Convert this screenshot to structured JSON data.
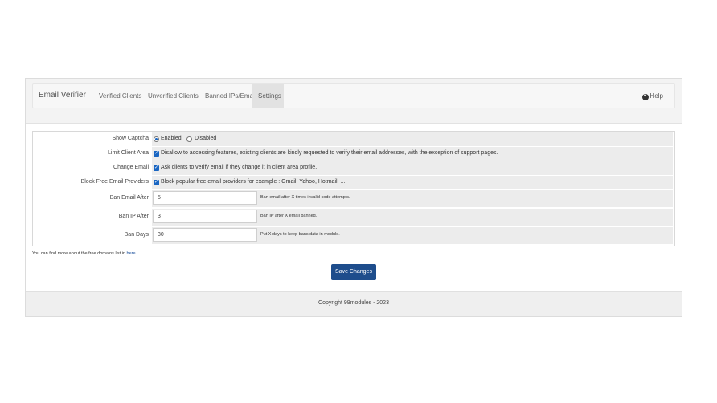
{
  "header": {
    "brand": "Email Verifier",
    "tabs": [
      {
        "label": "Verified Clients",
        "active": false
      },
      {
        "label": "Unverified Clients",
        "active": false
      },
      {
        "label": "Banned IPs/Emails",
        "active": false
      },
      {
        "label": "Settings",
        "active": true
      }
    ],
    "help_label": "Help",
    "help_icon": "?"
  },
  "settings": {
    "show_captcha": {
      "label": "Show Captcha",
      "options": [
        "Enabled",
        "Disabled"
      ],
      "selected": "Enabled"
    },
    "limit_client_area": {
      "label": "Limit Client Area",
      "checked": true,
      "text": "Disallow to accessing features, existing clients are kindly requested to verify their email addresses, with the exception of support pages."
    },
    "change_email": {
      "label": "Change Email",
      "checked": true,
      "text": "Ask clients to verify email if they change it in client area profile."
    },
    "block_free_email": {
      "label": "Block Free Email Providers",
      "checked": true,
      "text": "Block popular free email providers for example : Gmail, Yahoo, Hotmail, ..."
    },
    "ban_email_after": {
      "label": "Ban Email After",
      "value": "5",
      "hint": "Ban email after X times invalid code attempts."
    },
    "ban_ip_after": {
      "label": "Ban IP After",
      "value": "3",
      "hint": "Ban IP after X email banned."
    },
    "ban_days": {
      "label": "Ban Days",
      "value": "30",
      "hint": "Put X days to keep bans data in module."
    }
  },
  "note": {
    "text": "You can find more about the free domains list in",
    "link": "here"
  },
  "save_label": "Save Changes",
  "footer": "Copyright 99modules - 2023",
  "colors": {
    "accent": "#1e4d8c",
    "checkbox": "#1a66c2"
  }
}
